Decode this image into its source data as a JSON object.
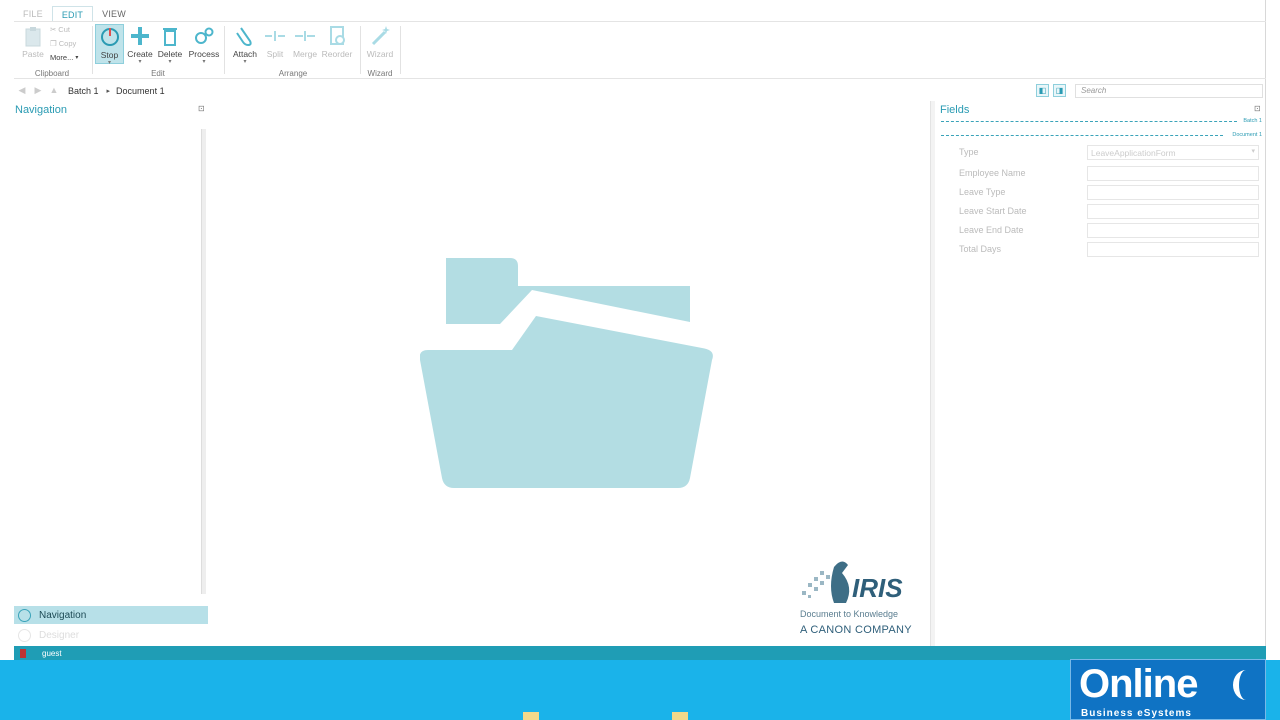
{
  "ribbon": {
    "tabs": [
      "FILE",
      "EDIT",
      "VIEW"
    ],
    "clipboard": {
      "paste": "Paste",
      "cut": "Cut",
      "copy": "Copy",
      "more": "More...",
      "label": "Clipboard"
    },
    "edit": {
      "stop": "Stop",
      "create": "Create",
      "delete": "Delete",
      "process": "Process",
      "label": "Edit"
    },
    "arrange": {
      "attach": "Attach",
      "split": "Split",
      "merge": "Merge",
      "reorder": "Reorder",
      "label": "Arrange"
    },
    "wizard": {
      "wizard": "Wizard",
      "label": "Wizard"
    }
  },
  "address": {
    "crumbs": [
      "Batch 1",
      "Document 1"
    ],
    "search_placeholder": "Search"
  },
  "nav_panel": {
    "title": "Navigation",
    "items": [
      "Navigation",
      "Designer"
    ]
  },
  "fields_panel": {
    "title": "Fields",
    "batch_label": "Batch 1",
    "document_label": "Document 1",
    "fields": [
      {
        "label": "Type",
        "value": "LeaveApplicationForm"
      },
      {
        "label": "Employee Name",
        "value": ""
      },
      {
        "label": "Leave Type",
        "value": ""
      },
      {
        "label": "Leave Start Date",
        "value": ""
      },
      {
        "label": "Leave End Date",
        "value": ""
      },
      {
        "label": "Total Days",
        "value": ""
      }
    ]
  },
  "logo": {
    "name": "IRIS",
    "tagline": "Document to Knowledge",
    "company": "A CANON COMPANY"
  },
  "status": {
    "user": "guest"
  },
  "watermark": {
    "line1": "Online",
    "line2": "Business eSystems"
  },
  "colors": {
    "accent": "#2a9bb3",
    "folder": "#b3dde3",
    "status_bar": "#1f9db5"
  }
}
